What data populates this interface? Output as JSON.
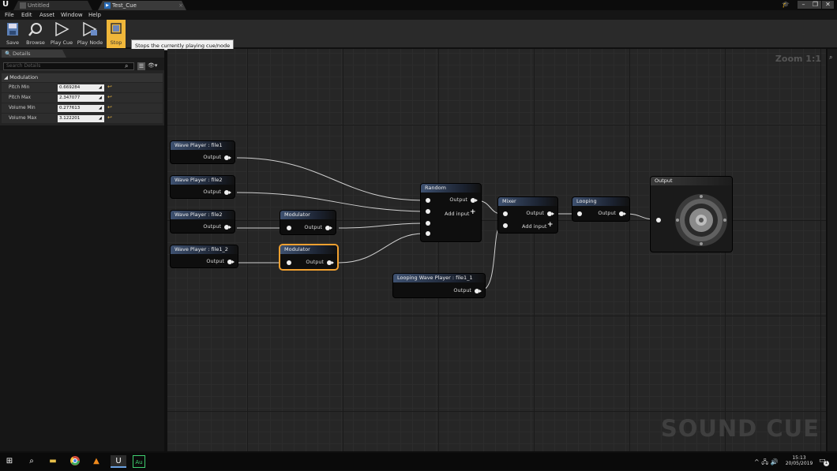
{
  "titlebar": {
    "tabs": [
      {
        "label": "Untitled"
      },
      {
        "label": "Test_Cue"
      }
    ]
  },
  "menu": [
    "File",
    "Edit",
    "Asset",
    "Window",
    "Help"
  ],
  "toolbar": {
    "save": "Save",
    "browse": "Browse",
    "play_cue": "Play Cue",
    "play_node": "Play Node",
    "stop": "Stop",
    "tooltip": "Stops the currently playing cue/node"
  },
  "details": {
    "tab": "Details",
    "search_placeholder": "Search Details",
    "section": "Modulation",
    "props": [
      {
        "label": "Pitch Min",
        "value": "0.669284"
      },
      {
        "label": "Pitch Max",
        "value": "2.347077"
      },
      {
        "label": "Volume Min",
        "value": "0.277613"
      },
      {
        "label": "Volume Max",
        "value": "3.122201"
      }
    ]
  },
  "graph": {
    "zoom": "Zoom 1:1",
    "watermark": "SOUND CUE",
    "nodes": {
      "wp1": {
        "title": "Wave Player : file1",
        "out": "Output"
      },
      "wp2": {
        "title": "Wave Player : file2",
        "out": "Output"
      },
      "wp3": {
        "title": "Wave Player : file2",
        "out": "Output"
      },
      "wp4": {
        "title": "Wave Player : file1_2",
        "out": "Output"
      },
      "mod1": {
        "title": "Modulator",
        "out": "Output"
      },
      "mod2": {
        "title": "Modulator",
        "out": "Output"
      },
      "random": {
        "title": "Random",
        "out": "Output",
        "add": "Add input"
      },
      "mixer": {
        "title": "Mixer",
        "out": "Output",
        "add": "Add input"
      },
      "looping": {
        "title": "Looping",
        "out": "Output"
      },
      "lwp": {
        "title": "Looping Wave Player : file1_1",
        "out": "Output"
      },
      "output": {
        "title": "Output"
      }
    }
  },
  "taskbar": {
    "time": "15:13",
    "date": "20/05/2019",
    "notifications": "1"
  }
}
